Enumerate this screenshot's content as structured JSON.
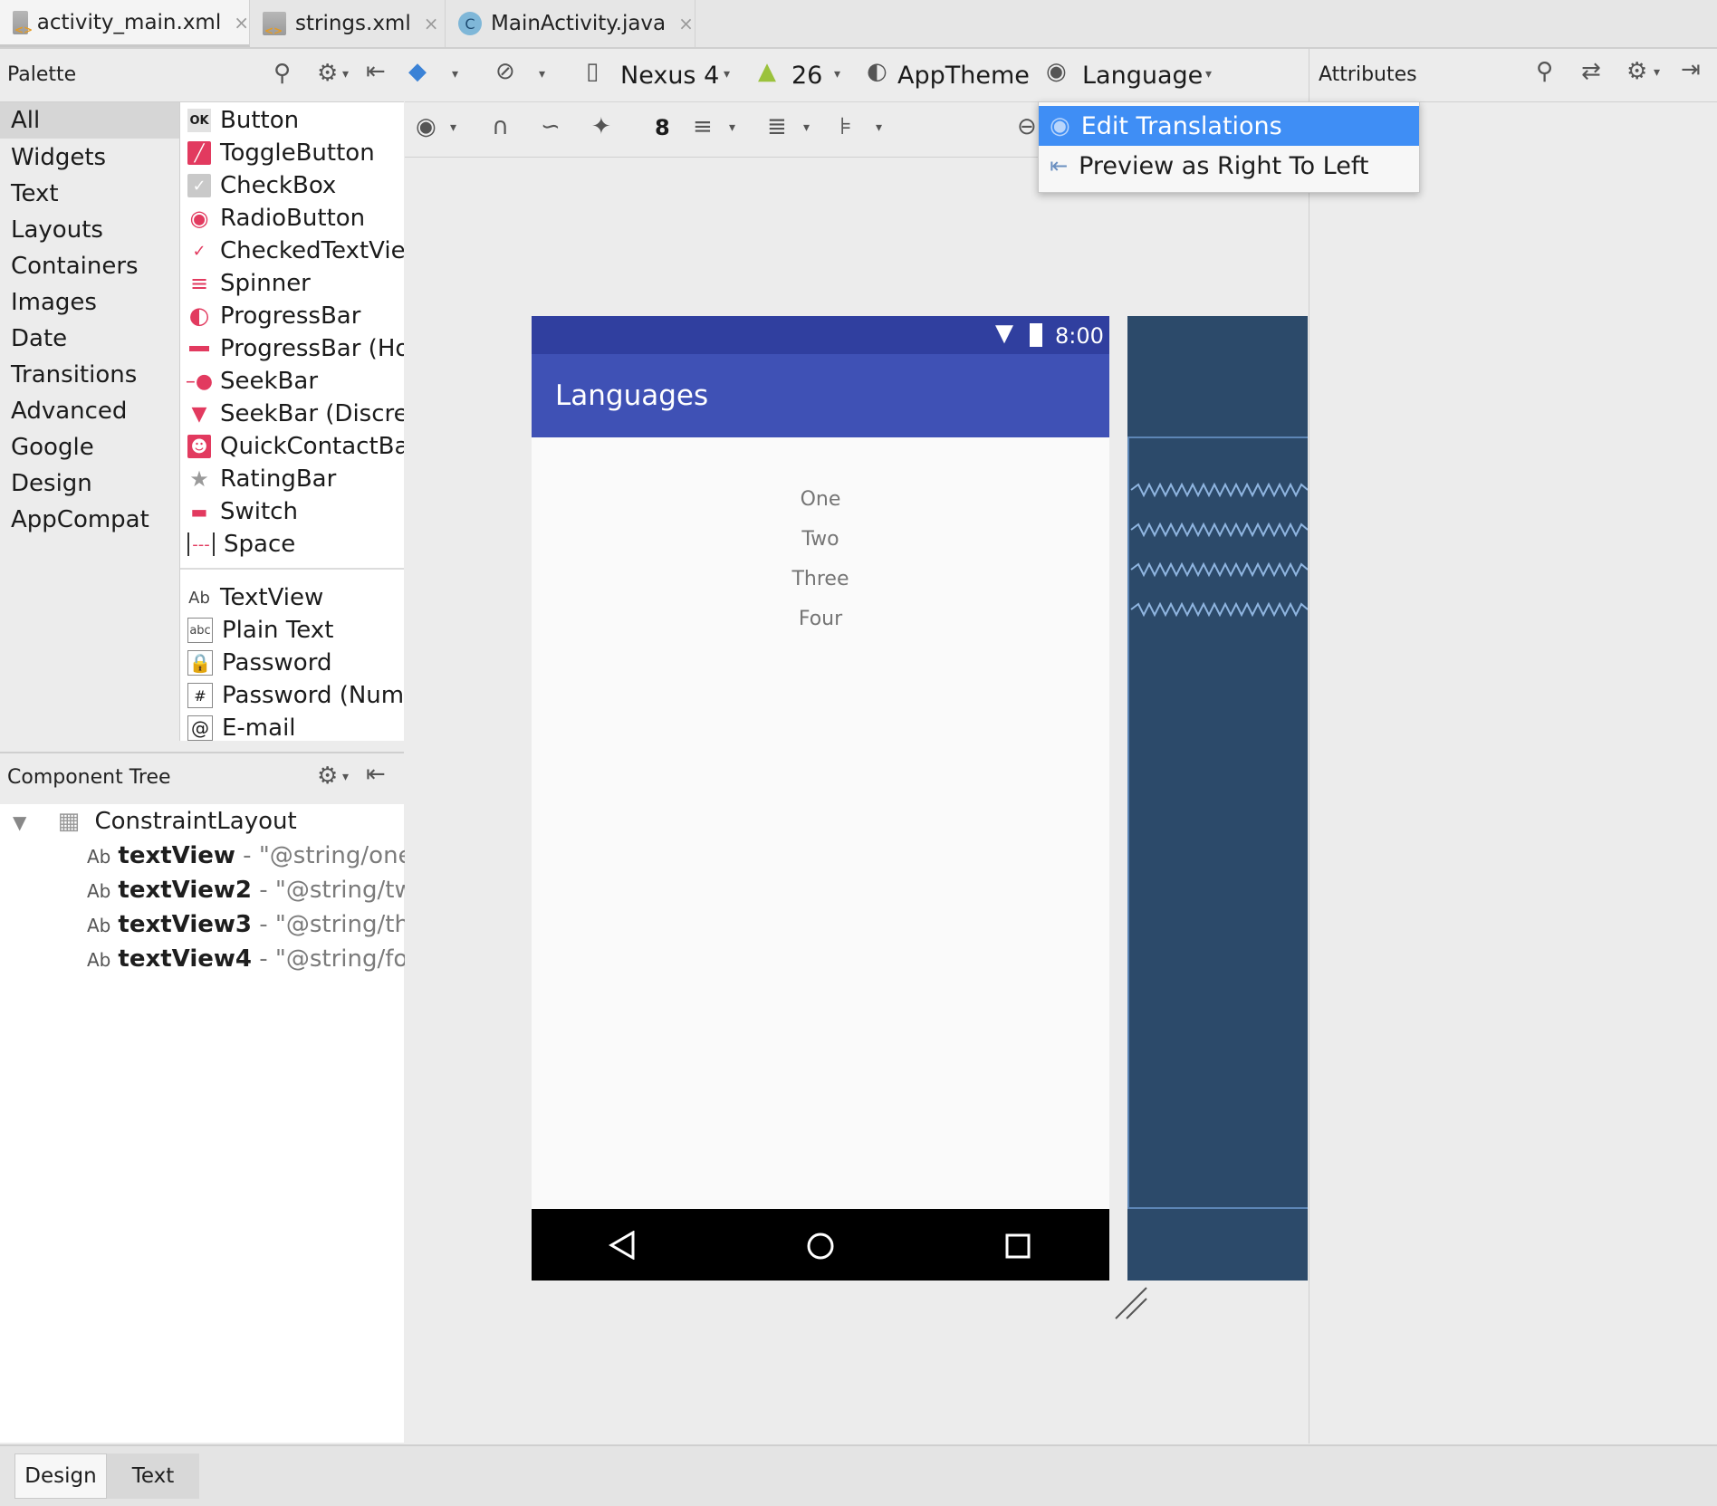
{
  "tabs": [
    {
      "label": "activity_main.xml",
      "close": "×"
    },
    {
      "label": "strings.xml",
      "close": "×"
    },
    {
      "label": "MainActivity.java",
      "close": "×"
    }
  ],
  "palette": {
    "title": "Palette",
    "categories": [
      "All",
      "Widgets",
      "Text",
      "Layouts",
      "Containers",
      "Images",
      "Date",
      "Transitions",
      "Advanced",
      "Google",
      "Design",
      "AppCompat"
    ],
    "widgets": [
      "Button",
      "ToggleButton",
      "CheckBox",
      "RadioButton",
      "CheckedTextView",
      "Spinner",
      "ProgressBar",
      "ProgressBar (Horizontal)",
      "SeekBar",
      "SeekBar (Discrete)",
      "QuickContactBadge",
      "RatingBar",
      "Switch",
      "Space"
    ],
    "text_items": [
      "TextView",
      "Plain Text",
      "Password",
      "Password (Numeric)",
      "E-mail"
    ],
    "icon_text": {
      "ok": "OK",
      "ab": "Ab",
      "abc": "abc"
    }
  },
  "toolbar": {
    "device": "Nexus 4",
    "api": "26",
    "theme": "AppTheme",
    "language": "Language",
    "margin": "8"
  },
  "dropdown": {
    "edit_translations": "Edit Translations",
    "preview_rtl": "Preview as Right To Left"
  },
  "device": {
    "time": "8:00",
    "app_title": "Languages",
    "texts": [
      "One",
      "Two",
      "Three",
      "Four"
    ]
  },
  "attributes": {
    "title": "Attributes"
  },
  "component_tree": {
    "title": "Component Tree",
    "root": "ConstraintLayout",
    "children": [
      {
        "id": "textView",
        "value": "\"@string/one\""
      },
      {
        "id": "textView2",
        "value": "\"@string/two\""
      },
      {
        "id": "textView3",
        "value": "\"@string/three\""
      },
      {
        "id": "textView4",
        "value": "\"@string/four\""
      }
    ],
    "dash": "-"
  },
  "bottom_tabs": [
    "Design",
    "Text"
  ],
  "colors": {
    "accent": "#3f8ef5",
    "app_primary": "#3f51b5",
    "status": "#303f9f",
    "blueprint": "#2c4a6a"
  }
}
